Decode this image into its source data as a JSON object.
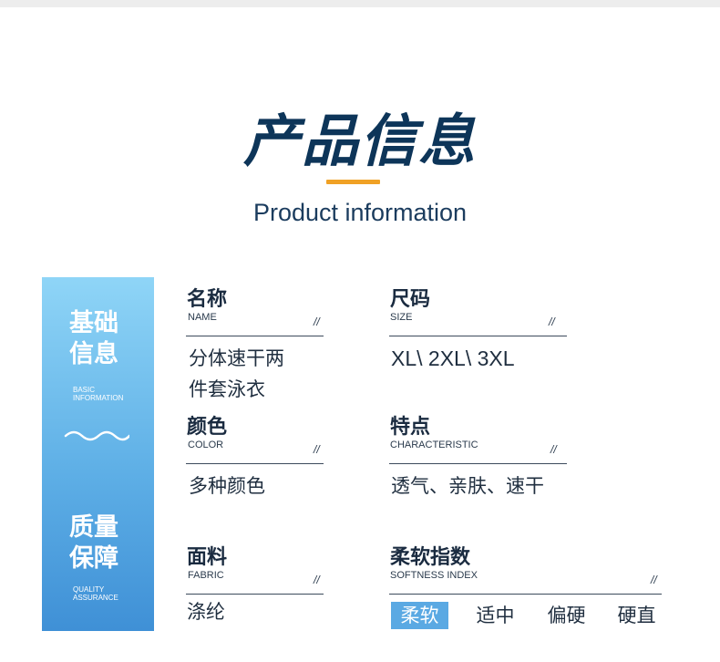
{
  "header": {
    "title": "产品信息",
    "subtitle": "Product information",
    "accent_color": "#f0a125",
    "title_color": "#0d3559"
  },
  "side": {
    "basic_zh_line1": "基础",
    "basic_zh_line2": "信息",
    "basic_en_line1": "BASIC",
    "basic_en_line2": "INFORMATION",
    "quality_zh_line1": "质量",
    "quality_zh_line2": "保障",
    "quality_en_line1": "QUALITY",
    "quality_en_line2": "ASSURANCE",
    "wave_icon": "wave-icon",
    "gradient_top": "#8fd5f7",
    "gradient_bottom": "#3f90d6"
  },
  "fields": {
    "name": {
      "label_zh": "名称",
      "label_en": "NAME",
      "slash": "//",
      "value_line1": "分体速干两",
      "value_line2": "件套泳衣"
    },
    "size": {
      "label_zh": "尺码",
      "label_en": "SIZE",
      "slash": "//",
      "value": "XL\\ 2XL\\ 3XL"
    },
    "color": {
      "label_zh": "颜色",
      "label_en": "COLOR",
      "slash": "//",
      "value": "多种颜色"
    },
    "feature": {
      "label_zh": "特点",
      "label_en": "CHARACTERISTIC",
      "slash": "//",
      "value": "透气、亲肤、速干"
    },
    "fabric": {
      "label_zh": "面料",
      "label_en": "FABRIC",
      "slash": "//",
      "value": "涤纶"
    },
    "softness": {
      "label_zh": "柔软指数",
      "label_en": "SOFTNESS INDEX",
      "slash": "//",
      "options": [
        "柔软",
        "适中",
        "偏硬",
        "硬直"
      ],
      "selected": "柔软",
      "selected_color": "#5aa9e3"
    }
  }
}
